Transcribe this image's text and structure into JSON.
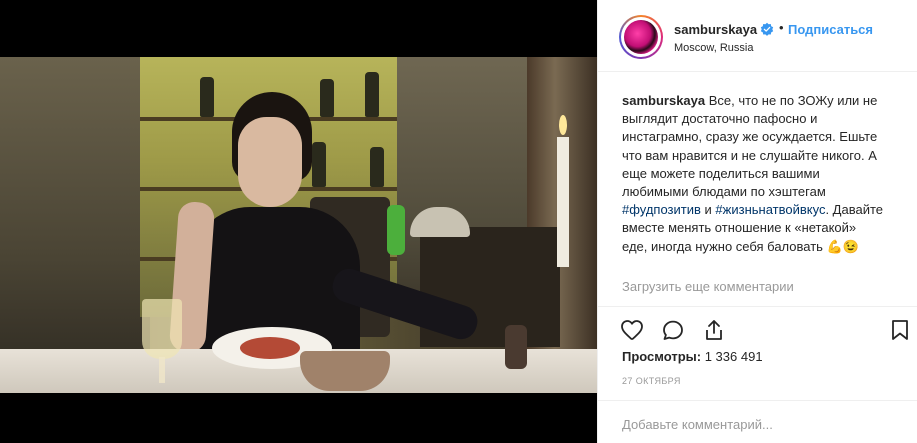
{
  "post": {
    "username": "samburskaya",
    "follow_label": "Подписаться",
    "separator": "•",
    "location": "Moscow, Russia",
    "caption_user": "samburskaya",
    "caption_part1": "Все, что не по ЗОЖу или не выглядит достаточно пафосно и инстаграмно, сразу же осуждается. Ешьте что вам нравится и не слушайте никого. А еще можете поделиться вашими любимыми блюдами по хэштегам",
    "hashtag1": "#фудпозитив",
    "conjunction": "и",
    "hashtag2": "#жизньнатвойвкус",
    "caption_part2": ". Давайте вместе менять отношение к «нетакой» еде, иногда нужно себя баловать 💪😉",
    "load_more": "Загрузить еще комментарии",
    "views_label": "Просмотры:",
    "views_count": "1 336 491",
    "date": "27 ОКТЯБРЯ",
    "comment_placeholder": "Добавьте комментарий..."
  },
  "colors": {
    "link": "#3897f0",
    "hashtag": "#003569",
    "muted": "#999999",
    "text": "#262626"
  },
  "icons": [
    "verified-badge-icon",
    "heart-icon",
    "comment-icon",
    "share-icon",
    "bookmark-icon"
  ]
}
